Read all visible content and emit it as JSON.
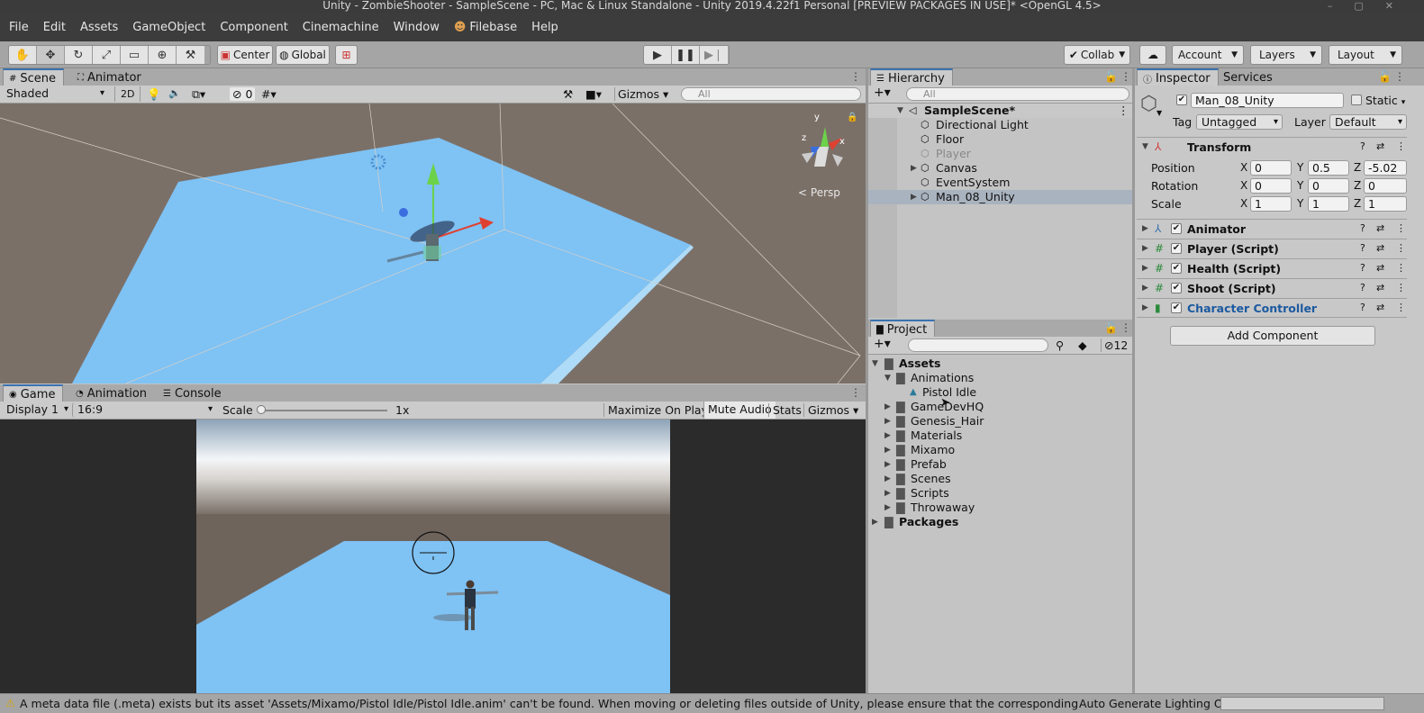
{
  "window": {
    "title": "Unity - ZombieShooter - SampleScene - PC, Mac & Linux Standalone - Unity 2019.4.22f1 Personal [PREVIEW PACKAGES IN USE]* <OpenGL 4.5>"
  },
  "menu": [
    "File",
    "Edit",
    "Assets",
    "GameObject",
    "Component",
    "Cinemachine",
    "Window",
    "Filebase",
    "Help"
  ],
  "toolbar": {
    "pivot": "Center",
    "space": "Global",
    "collab": "Collab",
    "account": "Account",
    "layers": "Layers",
    "layout": "Layout"
  },
  "scene": {
    "tabs": [
      "Scene",
      "Animator"
    ],
    "shading": "Shaded",
    "mode_2d": "2D",
    "hidden_count": "0",
    "gizmos": "Gizmos",
    "search_placeholder": "All",
    "persp_label": "Persp"
  },
  "game": {
    "tabs": [
      "Game",
      "Animation",
      "Console"
    ],
    "display": "Display 1",
    "aspect": "16:9",
    "scale_label": "Scale",
    "scale_value": "1x",
    "maximize": "Maximize On Play",
    "mute": "Mute Audio",
    "stats": "Stats",
    "gizmos": "Gizmos"
  },
  "hierarchy": {
    "tab": "Hierarchy",
    "search_placeholder": "All",
    "scene": "SampleScene*",
    "items": [
      "Directional Light",
      "Floor",
      "Player",
      "Canvas",
      "EventSystem",
      "Man_08_Unity"
    ]
  },
  "project": {
    "tab": "Project",
    "hidden_count": "12",
    "assets": "Assets",
    "animations": "Animations",
    "pistol_idle": "Pistol Idle",
    "folders": [
      "GameDevHQ",
      "Genesis_Hair",
      "Materials",
      "Mixamo",
      "Prefab",
      "Scenes",
      "Scripts",
      "Throwaway"
    ],
    "packages": "Packages"
  },
  "inspector": {
    "tabs": [
      "Inspector",
      "Services"
    ],
    "object_name": "Man_08_Unity",
    "static_label": "Static",
    "tag_label": "Tag",
    "tag_value": "Untagged",
    "layer_label": "Layer",
    "layer_value": "Default",
    "transform": {
      "title": "Transform",
      "rows": [
        {
          "label": "Position",
          "x": "0",
          "y": "0.5",
          "z": "-5.02"
        },
        {
          "label": "Rotation",
          "x": "0",
          "y": "0",
          "z": "0"
        },
        {
          "label": "Scale",
          "x": "1",
          "y": "1",
          "z": "1"
        }
      ]
    },
    "components": [
      "Animator",
      "Player (Script)",
      "Health (Script)",
      "Shoot (Script)",
      "Character Controller"
    ],
    "add_component": "Add Component"
  },
  "status": {
    "message": "A meta data file (.meta) exists but its asset 'Assets/Mixamo/Pistol Idle/Pistol Idle.anim' can't be found. When moving or deleting files outside of Unity, please ensure that the corresponding .meta file is moved or delete",
    "lighting": "Auto Generate Lighting Off"
  },
  "colors": {
    "accent": "#3a72b0",
    "link_blue": "#1b5aa0",
    "floor_blue": "#7fc2f4",
    "scene_bg": "#7b7068",
    "menubar": "#3c3c3c"
  }
}
